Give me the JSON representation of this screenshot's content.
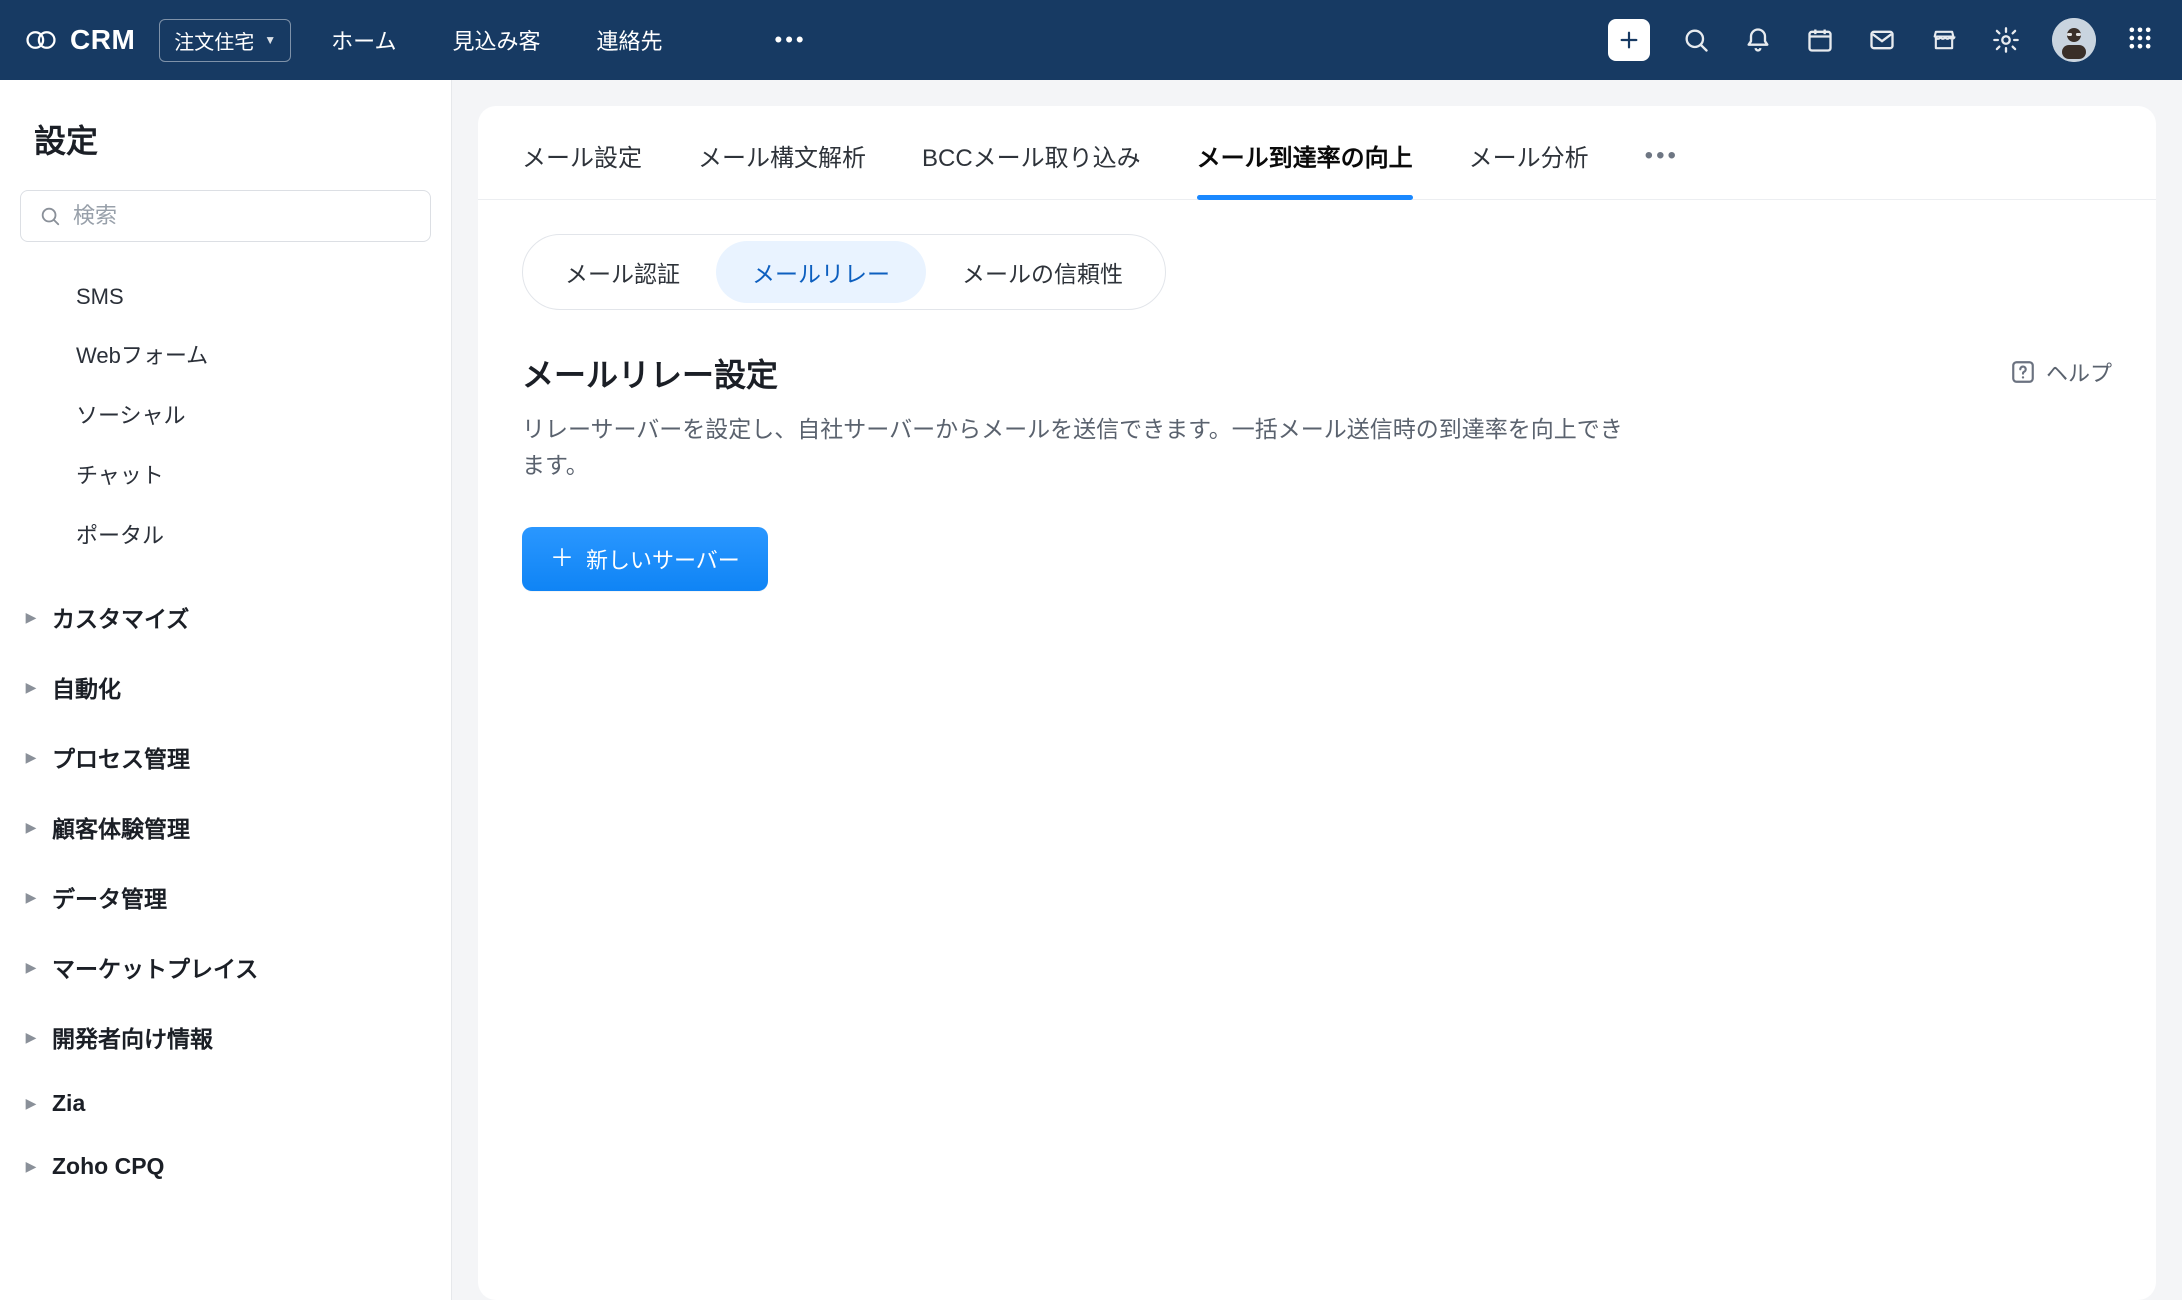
{
  "topbar": {
    "product_name": "CRM",
    "app_switcher_label": "注文住宅",
    "nav": [
      "ホーム",
      "見込み客",
      "連絡先"
    ],
    "more_glyph": "•••"
  },
  "icons": {
    "plus": "plus-icon",
    "search": "search-icon",
    "bell": "bell-icon",
    "calendar": "calendar-icon",
    "mail": "mail-icon",
    "store": "store-icon",
    "gear": "gear-icon",
    "apps_grid": "apps-grid-icon"
  },
  "sidebar": {
    "title": "設定",
    "search_placeholder": "検索",
    "subitems": [
      "SMS",
      "Webフォーム",
      "ソーシャル",
      "チャット",
      "ポータル"
    ],
    "groups": [
      "カスタマイズ",
      "自動化",
      "プロセス管理",
      "顧客体験管理",
      "データ管理",
      "マーケットプレイス",
      "開発者向け情報",
      "Zia",
      "Zoho CPQ"
    ]
  },
  "tabs": {
    "items": [
      "メール設定",
      "メール構文解析",
      "BCCメール取り込み",
      "メール到達率の向上",
      "メール分析"
    ],
    "active_index": 3,
    "more_glyph": "•••"
  },
  "pills": {
    "items": [
      "メール認証",
      "メールリレー",
      "メールの信頼性"
    ],
    "active_index": 1
  },
  "content": {
    "title": "メールリレー設定",
    "description": "リレーサーバーを設定し、自社サーバーからメールを送信できます。一括メール送信時の到達率を向上できます。",
    "help_label": "ヘルプ",
    "new_server_label": "新しいサーバー"
  }
}
